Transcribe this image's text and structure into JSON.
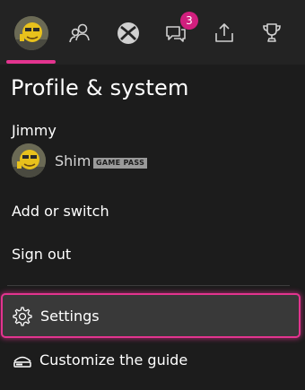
{
  "tabs": [
    {
      "name": "profile",
      "icon": "avatar-icon",
      "selected": true
    },
    {
      "name": "people",
      "icon": "people-icon"
    },
    {
      "name": "xbox",
      "icon": "xbox-logo-icon"
    },
    {
      "name": "messages",
      "icon": "chat-icon",
      "badge": "3"
    },
    {
      "name": "share",
      "icon": "share-icon"
    },
    {
      "name": "achievements",
      "icon": "trophy-icon"
    }
  ],
  "panel": {
    "title": "Profile & system",
    "username": "Jimmy",
    "gamertag": "Shim",
    "gamepass_badge": "GAME PASS"
  },
  "menu": {
    "add_or_switch": "Add or switch",
    "sign_out": "Sign out",
    "settings": "Settings",
    "customize_guide": "Customize the guide"
  },
  "colors": {
    "accent": "#e3348f",
    "badge": "#d11f7e",
    "background": "#1c1c1c",
    "selected_row": "#393939"
  }
}
